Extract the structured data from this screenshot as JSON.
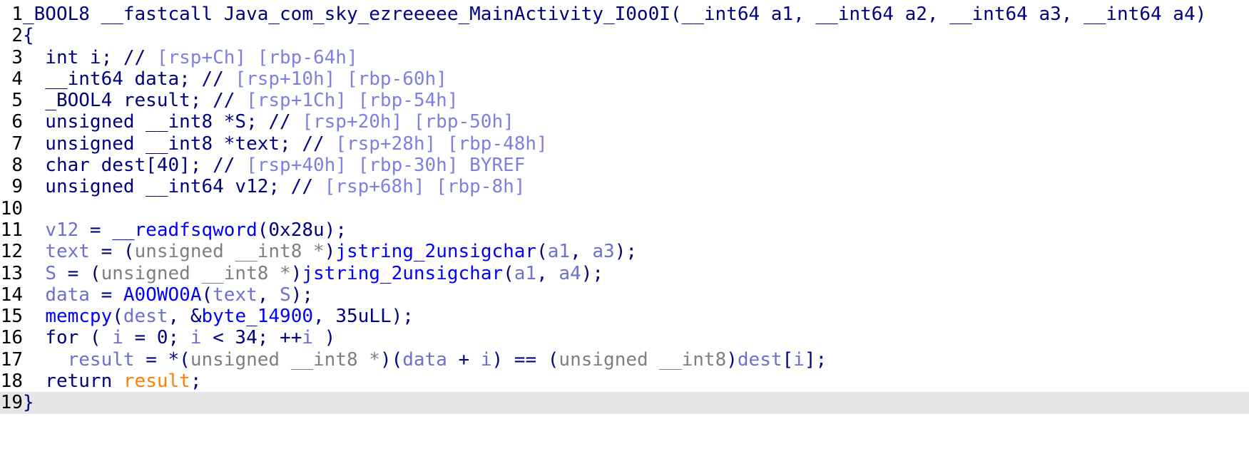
{
  "pseudocode": {
    "lines": [
      {
        "n": "1",
        "tokens": [
          {
            "t": "_BOOL8 __fastcall Java_com_sky_ezreeeee_MainActivity_I0o0I(__int64 a1, __int64 a2, __int64 a3, __int64 a4)",
            "c": "txt"
          }
        ]
      },
      {
        "n": "2",
        "tokens": [
          {
            "t": "{",
            "c": "txt"
          }
        ]
      },
      {
        "n": "3",
        "tokens": [
          {
            "t": "  int i; // ",
            "c": "txt"
          },
          {
            "t": "[rsp+Ch] [rbp-64h]",
            "c": "cmt"
          }
        ]
      },
      {
        "n": "4",
        "tokens": [
          {
            "t": "  __int64 data; // ",
            "c": "txt"
          },
          {
            "t": "[rsp+10h] [rbp-60h]",
            "c": "cmt"
          }
        ]
      },
      {
        "n": "5",
        "tokens": [
          {
            "t": "  _BOOL4 result; // ",
            "c": "txt"
          },
          {
            "t": "[rsp+1Ch] [rbp-54h]",
            "c": "cmt"
          }
        ]
      },
      {
        "n": "6",
        "tokens": [
          {
            "t": "  unsigned __int8 *S; // ",
            "c": "txt"
          },
          {
            "t": "[rsp+20h] [rbp-50h]",
            "c": "cmt"
          }
        ]
      },
      {
        "n": "7",
        "tokens": [
          {
            "t": "  unsigned __int8 *text; // ",
            "c": "txt"
          },
          {
            "t": "[rsp+28h] [rbp-48h]",
            "c": "cmt"
          }
        ]
      },
      {
        "n": "8",
        "tokens": [
          {
            "t": "  char dest[40]; // ",
            "c": "txt"
          },
          {
            "t": "[rsp+40h] [rbp-30h] BYREF",
            "c": "cmt"
          }
        ]
      },
      {
        "n": "9",
        "tokens": [
          {
            "t": "  unsigned __int64 v12; // ",
            "c": "txt"
          },
          {
            "t": "[rsp+68h] [rbp-8h]",
            "c": "cmt"
          }
        ]
      },
      {
        "n": "10",
        "tokens": [
          {
            "t": "",
            "c": "txt"
          }
        ]
      },
      {
        "n": "11",
        "tokens": [
          {
            "t": "  ",
            "c": "txt"
          },
          {
            "t": "v12",
            "c": "var"
          },
          {
            "t": " = ",
            "c": "txt"
          },
          {
            "t": "__readfsqword",
            "c": "fn"
          },
          {
            "t": "(0x28u);",
            "c": "txt"
          }
        ]
      },
      {
        "n": "12",
        "tokens": [
          {
            "t": "  ",
            "c": "txt"
          },
          {
            "t": "text",
            "c": "var"
          },
          {
            "t": " = (",
            "c": "txt"
          },
          {
            "t": "unsigned __int8 *",
            "c": "cast"
          },
          {
            "t": ")",
            "c": "txt"
          },
          {
            "t": "jstring_2unsigchar",
            "c": "fn"
          },
          {
            "t": "(",
            "c": "txt"
          },
          {
            "t": "a1",
            "c": "var"
          },
          {
            "t": ", ",
            "c": "txt"
          },
          {
            "t": "a3",
            "c": "var"
          },
          {
            "t": ");",
            "c": "txt"
          }
        ]
      },
      {
        "n": "13",
        "tokens": [
          {
            "t": "  ",
            "c": "txt"
          },
          {
            "t": "S",
            "c": "var"
          },
          {
            "t": " = (",
            "c": "txt"
          },
          {
            "t": "unsigned __int8 *",
            "c": "cast"
          },
          {
            "t": ")",
            "c": "txt"
          },
          {
            "t": "jstring_2unsigchar",
            "c": "fn"
          },
          {
            "t": "(",
            "c": "txt"
          },
          {
            "t": "a1",
            "c": "var"
          },
          {
            "t": ", ",
            "c": "txt"
          },
          {
            "t": "a4",
            "c": "var"
          },
          {
            "t": ");",
            "c": "txt"
          }
        ]
      },
      {
        "n": "14",
        "tokens": [
          {
            "t": "  ",
            "c": "txt"
          },
          {
            "t": "data",
            "c": "var"
          },
          {
            "t": " = ",
            "c": "txt"
          },
          {
            "t": "A0OWO0A",
            "c": "fn"
          },
          {
            "t": "(",
            "c": "txt"
          },
          {
            "t": "text",
            "c": "var"
          },
          {
            "t": ", ",
            "c": "txt"
          },
          {
            "t": "S",
            "c": "var"
          },
          {
            "t": ");",
            "c": "txt"
          }
        ]
      },
      {
        "n": "15",
        "tokens": [
          {
            "t": "  ",
            "c": "txt"
          },
          {
            "t": "memcpy",
            "c": "fn"
          },
          {
            "t": "(",
            "c": "txt"
          },
          {
            "t": "dest",
            "c": "var"
          },
          {
            "t": ", &",
            "c": "txt"
          },
          {
            "t": "byte_14900",
            "c": "fn"
          },
          {
            "t": ", 35uLL);",
            "c": "txt"
          }
        ]
      },
      {
        "n": "16",
        "tokens": [
          {
            "t": "  for ( ",
            "c": "txt"
          },
          {
            "t": "i",
            "c": "var"
          },
          {
            "t": " = 0; ",
            "c": "txt"
          },
          {
            "t": "i",
            "c": "var"
          },
          {
            "t": " < 34; ++",
            "c": "txt"
          },
          {
            "t": "i",
            "c": "var"
          },
          {
            "t": " )",
            "c": "txt"
          }
        ]
      },
      {
        "n": "17",
        "tokens": [
          {
            "t": "    ",
            "c": "txt"
          },
          {
            "t": "result",
            "c": "var"
          },
          {
            "t": " = *(",
            "c": "txt"
          },
          {
            "t": "unsigned __int8 *",
            "c": "cast"
          },
          {
            "t": ")(",
            "c": "txt"
          },
          {
            "t": "data",
            "c": "var"
          },
          {
            "t": " + ",
            "c": "txt"
          },
          {
            "t": "i",
            "c": "var"
          },
          {
            "t": ") == (",
            "c": "txt"
          },
          {
            "t": "unsigned __int8",
            "c": "cast"
          },
          {
            "t": ")",
            "c": "txt"
          },
          {
            "t": "dest",
            "c": "var"
          },
          {
            "t": "[",
            "c": "txt"
          },
          {
            "t": "i",
            "c": "var"
          },
          {
            "t": "];",
            "c": "txt"
          }
        ]
      },
      {
        "n": "18",
        "tokens": [
          {
            "t": "  return ",
            "c": "txt"
          },
          {
            "t": "result",
            "c": "ret"
          },
          {
            "t": ";",
            "c": "txt"
          }
        ]
      },
      {
        "n": "19",
        "tokens": [
          {
            "t": "}",
            "c": "txt"
          }
        ],
        "current": true
      }
    ]
  }
}
